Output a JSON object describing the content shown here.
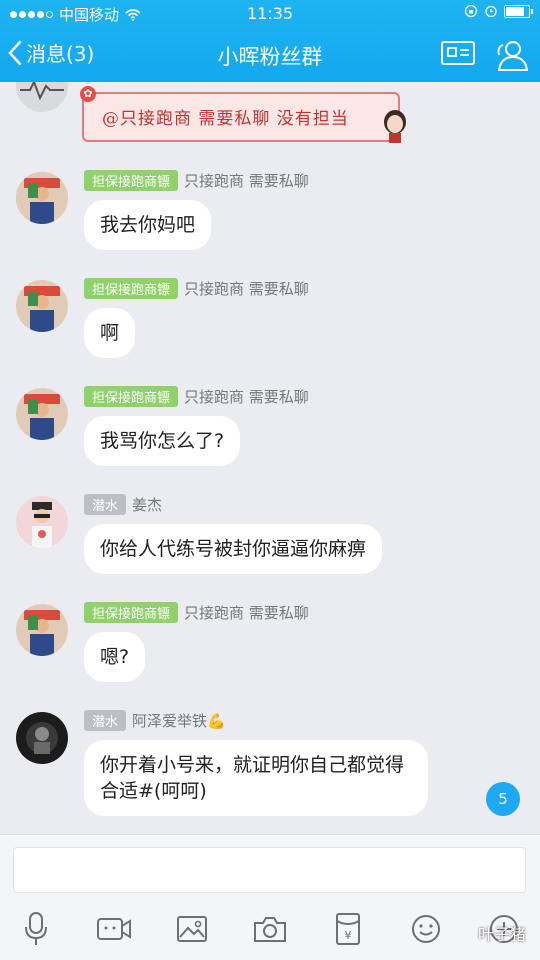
{
  "status": {
    "carrier": "中国移动",
    "time": "11:35",
    "battery_level": 0.82
  },
  "nav": {
    "back_label": "消息(3)",
    "title": "小晖粉丝群"
  },
  "banner": {
    "text": "@只接跑商 需要私聊 没有担当"
  },
  "messages": [
    {
      "badge": "担保接跑商镖",
      "sender": "只接跑商 需要私聊",
      "text": "我去你妈吧"
    },
    {
      "badge": "担保接跑商镖",
      "sender": "只接跑商 需要私聊",
      "text": "啊"
    },
    {
      "badge": "担保接跑商镖",
      "sender": "只接跑商 需要私聊",
      "text": "我骂你怎么了?"
    },
    {
      "badge": "潜水",
      "sender": "姜杰",
      "text": "你给人代练号被封你逼逼你麻痹"
    },
    {
      "badge": "担保接跑商镖",
      "sender": "只接跑商 需要私聊",
      "text": "嗯?"
    },
    {
      "badge": "潜水",
      "sender": "阿泽爱举铁💪",
      "text": "你开着小号来，就证明你自己都觉得合适#(呵呵)"
    }
  ],
  "unread_count": "5",
  "toolbar": {
    "icons": [
      "microphone-icon",
      "video-icon",
      "image-icon",
      "camera-icon",
      "red-packet-icon",
      "emoji-icon",
      "plus-icon"
    ]
  },
  "watermark": "叶子猪",
  "colors": {
    "header": "#13a8ee",
    "badge_green": "#8fd16a",
    "badge_gray": "#bcbfc5",
    "background": "#eaecf1"
  }
}
